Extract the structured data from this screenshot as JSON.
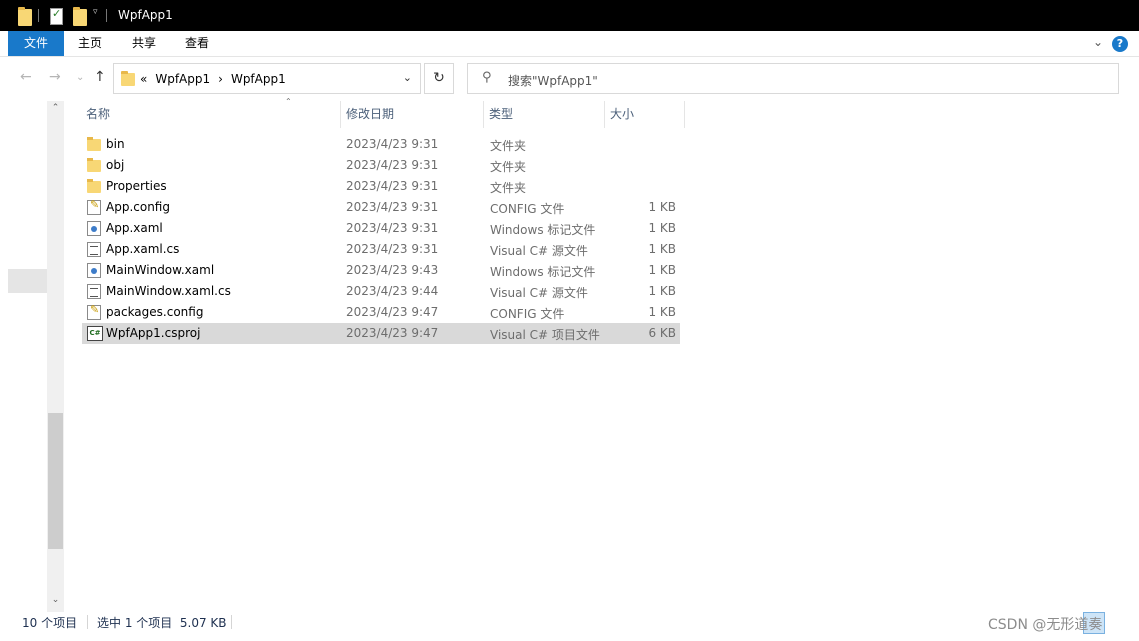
{
  "window": {
    "title": "WpfApp1"
  },
  "ribbon": {
    "tabs": [
      {
        "label": "文件",
        "active": true
      },
      {
        "label": "主页",
        "active": false
      },
      {
        "label": "共享",
        "active": false
      },
      {
        "label": "查看",
        "active": false
      }
    ]
  },
  "address": {
    "overflow": "«",
    "crumbs": [
      "WpfApp1",
      "WpfApp1"
    ],
    "separator": "›"
  },
  "search": {
    "placeholder": "搜索\"WpfApp1\""
  },
  "columns": {
    "name": "名称",
    "date": "修改日期",
    "type": "类型",
    "size": "大小"
  },
  "files": [
    {
      "name": "bin",
      "date": "2023/4/23 9:31",
      "type": "文件夹",
      "size": "",
      "icon": "folder-icon",
      "selected": false
    },
    {
      "name": "obj",
      "date": "2023/4/23 9:31",
      "type": "文件夹",
      "size": "",
      "icon": "folder-icon",
      "selected": false
    },
    {
      "name": "Properties",
      "date": "2023/4/23 9:31",
      "type": "文件夹",
      "size": "",
      "icon": "folder-icon",
      "selected": false
    },
    {
      "name": "App.config",
      "date": "2023/4/23 9:31",
      "type": "CONFIG 文件",
      "size": "1 KB",
      "icon": "config-file-icon",
      "selected": false
    },
    {
      "name": "App.xaml",
      "date": "2023/4/23 9:31",
      "type": "Windows 标记文件",
      "size": "1 KB",
      "icon": "xaml-file-icon",
      "selected": false
    },
    {
      "name": "App.xaml.cs",
      "date": "2023/4/23 9:31",
      "type": "Visual C# 源文件",
      "size": "1 KB",
      "icon": "cs-file-icon",
      "selected": false
    },
    {
      "name": "MainWindow.xaml",
      "date": "2023/4/23 9:43",
      "type": "Windows 标记文件",
      "size": "1 KB",
      "icon": "xaml-file-icon",
      "selected": false
    },
    {
      "name": "MainWindow.xaml.cs",
      "date": "2023/4/23 9:44",
      "type": "Visual C# 源文件",
      "size": "1 KB",
      "icon": "cs-file-icon",
      "selected": false
    },
    {
      "name": "packages.config",
      "date": "2023/4/23 9:47",
      "type": "CONFIG 文件",
      "size": "1 KB",
      "icon": "config-file-icon",
      "selected": false
    },
    {
      "name": "WpfApp1.csproj",
      "date": "2023/4/23 9:47",
      "type": "Visual C# 项目文件",
      "size": "6 KB",
      "icon": "csproj-file-icon",
      "selected": true
    }
  ],
  "status": {
    "item_count": "10 个项目",
    "selection": "选中 1 个项目  5.07 KB"
  },
  "watermark": "CSDN @无形道奏",
  "colors": {
    "accent": "#1979ca",
    "selected_row": "#d9d9d9",
    "titlebar": "#000000"
  }
}
